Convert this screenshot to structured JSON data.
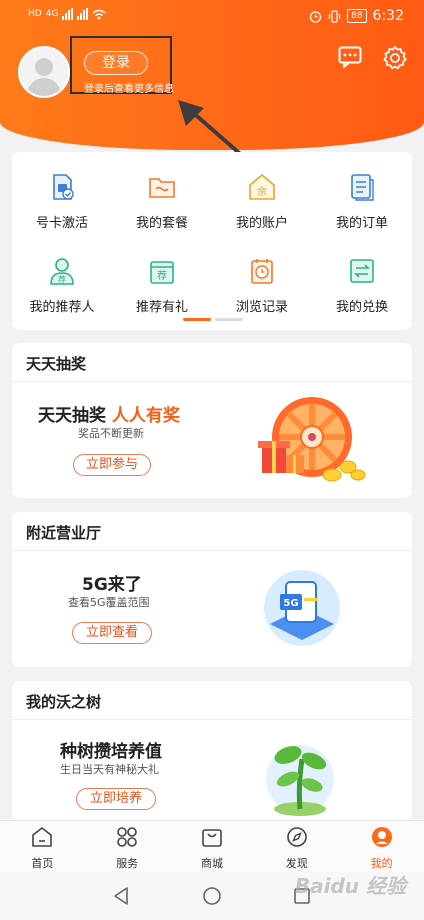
{
  "status_bar": {
    "signal_left": "HD",
    "signal_4g": "4G",
    "battery": "88",
    "time": "6:32"
  },
  "header": {
    "login_label": "登录",
    "login_hint": "登录后查看更多信息"
  },
  "grid": {
    "items": [
      {
        "label": "号卡激活",
        "icon": "sim-card-icon"
      },
      {
        "label": "我的套餐",
        "icon": "package-icon"
      },
      {
        "label": "我的账户",
        "icon": "account-icon"
      },
      {
        "label": "我的订单",
        "icon": "order-icon"
      },
      {
        "label": "我的推荐人",
        "icon": "referrer-icon"
      },
      {
        "label": "推荐有礼",
        "icon": "gift-icon"
      },
      {
        "label": "浏览记录",
        "icon": "history-icon"
      },
      {
        "label": "我的兑换",
        "icon": "exchange-icon"
      }
    ],
    "account_icon_text": "余",
    "referrer_icon_text": "荐",
    "gift_icon_text": "荐"
  },
  "sections": {
    "draw": {
      "title": "天天抽奖",
      "headline_a": "天天抽奖",
      "headline_b": "人人有奖",
      "sub": "奖品不断更新",
      "button": "立即参与"
    },
    "shop": {
      "title": "附近营业厅",
      "headline": "5G来了",
      "sub": "查看5G覆盖范围",
      "button": "立即查看",
      "badge": "5G"
    },
    "tree": {
      "title": "我的沃之树",
      "headline": "种树攒培养值",
      "sub": "生日当天有神秘大礼",
      "button": "立即培养"
    }
  },
  "tabs": [
    {
      "label": "首页",
      "icon": "home-icon"
    },
    {
      "label": "服务",
      "icon": "service-icon"
    },
    {
      "label": "商城",
      "icon": "shop-bag-icon"
    },
    {
      "label": "发现",
      "icon": "compass-icon"
    },
    {
      "label": "我的",
      "icon": "mine-icon"
    }
  ],
  "watermark": "Baidu 经验",
  "colors": {
    "accent": "#ff5a14",
    "header": "#ff6a1a"
  }
}
